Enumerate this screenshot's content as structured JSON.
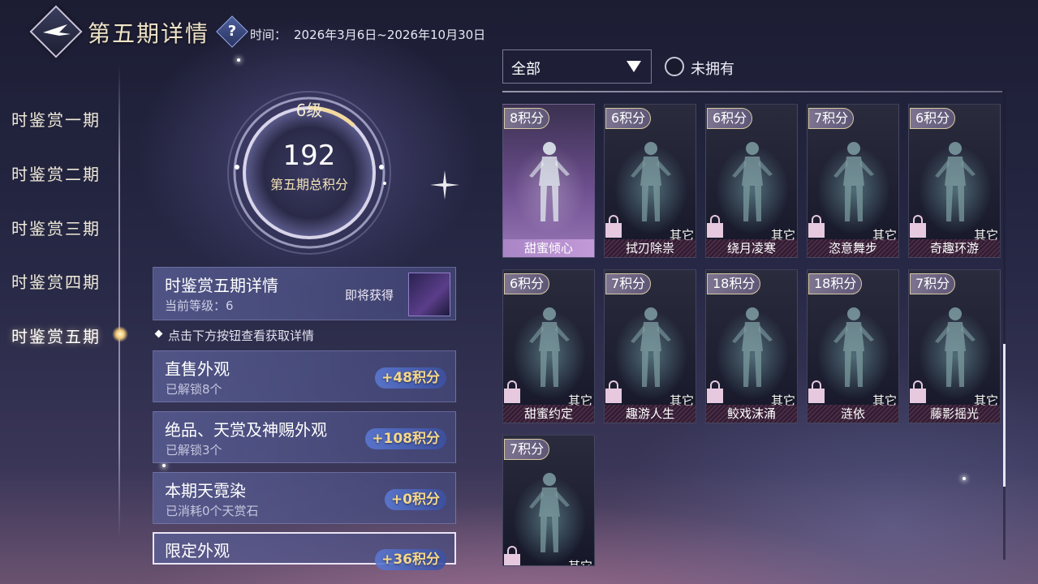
{
  "header": {
    "title": "第五期详情",
    "help_symbol": "?",
    "time_label": "时间：",
    "time_value": "2026年3月6日~2026年10月30日"
  },
  "nav": {
    "items": [
      {
        "label": "时鉴赏一期",
        "active": false
      },
      {
        "label": "时鉴赏二期",
        "active": false
      },
      {
        "label": "时鉴赏三期",
        "active": false
      },
      {
        "label": "时鉴赏四期",
        "active": false
      },
      {
        "label": "时鉴赏五期",
        "active": true
      }
    ]
  },
  "progress": {
    "level": "6级",
    "score": "192",
    "score_label": "第五期总积分"
  },
  "details": {
    "title": "时鉴赏五期详情",
    "current_level": "当前等级：6",
    "upcoming_label": "即将获得",
    "hint": "点击下方按钮查看获取详情"
  },
  "categories": [
    {
      "title": "直售外观",
      "subtitle": "已解锁8个",
      "points": "+48积分"
    },
    {
      "title": "绝品、天赏及神赐外观",
      "subtitle": "已解锁3个",
      "points": "+108积分"
    },
    {
      "title": "本期天霓染",
      "subtitle": "已消耗0个天赏石",
      "points": "+0积分"
    },
    {
      "title": "限定外观",
      "subtitle": "",
      "points": "+36积分"
    }
  ],
  "filter": {
    "selected": "全部",
    "unowned_label": "未拥有"
  },
  "cards": [
    {
      "points": "8积分",
      "name": "甜蜜倾心",
      "type": "",
      "owned": true
    },
    {
      "points": "6积分",
      "name": "拭刃除祟",
      "type": "其它",
      "owned": false
    },
    {
      "points": "6积分",
      "name": "绕月凌寒",
      "type": "其它",
      "owned": false
    },
    {
      "points": "7积分",
      "name": "恣意舞步",
      "type": "其它",
      "owned": false
    },
    {
      "points": "6积分",
      "name": "奇趣环游",
      "type": "其它",
      "owned": false
    },
    {
      "points": "6积分",
      "name": "甜蜜约定",
      "type": "其它",
      "owned": false
    },
    {
      "points": "7积分",
      "name": "趣游人生",
      "type": "其它",
      "owned": false
    },
    {
      "points": "18积分",
      "name": "鲛戏沫涌",
      "type": "其它",
      "owned": false
    },
    {
      "points": "18积分",
      "name": "涟依",
      "type": "其它",
      "owned": false
    },
    {
      "points": "7积分",
      "name": "藤影摇光",
      "type": "其它",
      "owned": false
    },
    {
      "points": "7积分",
      "name": "",
      "type": "其它",
      "owned": false
    }
  ],
  "colors": {
    "accent_gold": "#f6d78a",
    "owned_card": "#9a78b8",
    "lock": "#e6c9df"
  }
}
